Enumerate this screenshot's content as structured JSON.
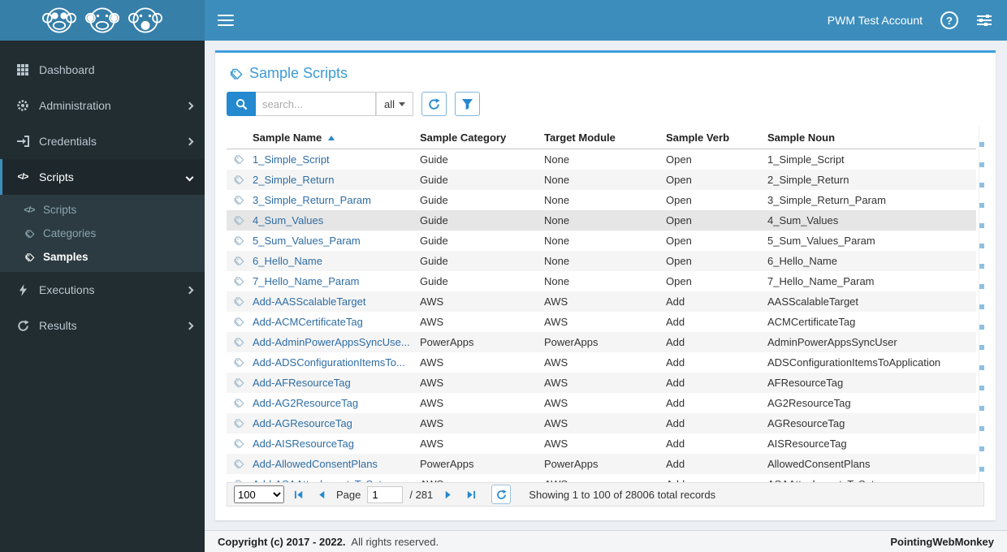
{
  "colors": {
    "navbar": "#3c8dbc",
    "logo_bg": "#367fa9",
    "accent": "#3d9bd6",
    "link": "#2e6da4",
    "sidebar_bg": "#222d32"
  },
  "topbar": {
    "account_label": "PWM Test Account"
  },
  "sidebar": {
    "items": [
      {
        "label": "Dashboard",
        "icon": "dashboard-grid"
      },
      {
        "label": "Administration",
        "icon": "gear"
      },
      {
        "label": "Credentials",
        "icon": "sign-in"
      },
      {
        "label": "Scripts",
        "icon": "code",
        "expanded": true,
        "children": [
          {
            "label": "Scripts",
            "icon": "code"
          },
          {
            "label": "Categories",
            "icon": "tag"
          },
          {
            "label": "Samples",
            "icon": "tags",
            "active": true
          }
        ]
      },
      {
        "label": "Executions",
        "icon": "bolt"
      },
      {
        "label": "Results",
        "icon": "history"
      }
    ]
  },
  "page": {
    "title": "Sample Scripts"
  },
  "toolbar": {
    "search_placeholder": "search...",
    "scope_selected": "all"
  },
  "table": {
    "columns": [
      "Sample Name",
      "Sample Category",
      "Target Module",
      "Sample Verb",
      "Sample Noun"
    ],
    "sorted_column": "Sample Name",
    "sort_direction": "asc",
    "rows": [
      {
        "name": "1_Simple_Script",
        "category": "Guide",
        "module": "None",
        "verb": "Open",
        "noun": "1_Simple_Script"
      },
      {
        "name": "2_Simple_Return",
        "category": "Guide",
        "module": "None",
        "verb": "Open",
        "noun": "2_Simple_Return"
      },
      {
        "name": "3_Simple_Return_Param",
        "category": "Guide",
        "module": "None",
        "verb": "Open",
        "noun": "3_Simple_Return_Param"
      },
      {
        "name": "4_Sum_Values",
        "category": "Guide",
        "module": "None",
        "verb": "Open",
        "noun": "4_Sum_Values",
        "state": "highlight"
      },
      {
        "name": "5_Sum_Values_Param",
        "category": "Guide",
        "module": "None",
        "verb": "Open",
        "noun": "5_Sum_Values_Param"
      },
      {
        "name": "6_Hello_Name",
        "category": "Guide",
        "module": "None",
        "verb": "Open",
        "noun": "6_Hello_Name"
      },
      {
        "name": "7_Hello_Name_Param",
        "category": "Guide",
        "module": "None",
        "verb": "Open",
        "noun": "7_Hello_Name_Param"
      },
      {
        "name": "Add-AASScalableTarget",
        "category": "AWS",
        "module": "AWS",
        "verb": "Add",
        "noun": "AASScalableTarget"
      },
      {
        "name": "Add-ACMCertificateTag",
        "category": "AWS",
        "module": "AWS",
        "verb": "Add",
        "noun": "ACMCertificateTag"
      },
      {
        "name": "Add-AdminPowerAppsSyncUse...",
        "category": "PowerApps",
        "module": "PowerApps",
        "verb": "Add",
        "noun": "AdminPowerAppsSyncUser"
      },
      {
        "name": "Add-ADSConfigurationItemsTo...",
        "category": "AWS",
        "module": "AWS",
        "verb": "Add",
        "noun": "ADSConfigurationItemsToApplication"
      },
      {
        "name": "Add-AFResourceTag",
        "category": "AWS",
        "module": "AWS",
        "verb": "Add",
        "noun": "AFResourceTag"
      },
      {
        "name": "Add-AG2ResourceTag",
        "category": "AWS",
        "module": "AWS",
        "verb": "Add",
        "noun": "AG2ResourceTag"
      },
      {
        "name": "Add-AGResourceTag",
        "category": "AWS",
        "module": "AWS",
        "verb": "Add",
        "noun": "AGResourceTag"
      },
      {
        "name": "Add-AISResourceTag",
        "category": "AWS",
        "module": "AWS",
        "verb": "Add",
        "noun": "AISResourceTag"
      },
      {
        "name": "Add-AllowedConsentPlans",
        "category": "PowerApps",
        "module": "PowerApps",
        "verb": "Add",
        "noun": "AllowedConsentPlans"
      },
      {
        "name": "Add-ASAAttachmentsToSet",
        "category": "AWS",
        "module": "AWS",
        "verb": "Add",
        "noun": "ASAAttachmentsToSet",
        "state": "clipped"
      }
    ]
  },
  "pager": {
    "page_size": "100",
    "page_label": "Page",
    "current_page": "1",
    "total_pages": "/ 281",
    "status": "Showing 1 to 100 of 28006 total records"
  },
  "footer": {
    "copyright_strong": "Copyright (c) 2017 - 2022.",
    "copyright_text": "All rights reserved.",
    "brand": "PointingWebMonkey"
  }
}
